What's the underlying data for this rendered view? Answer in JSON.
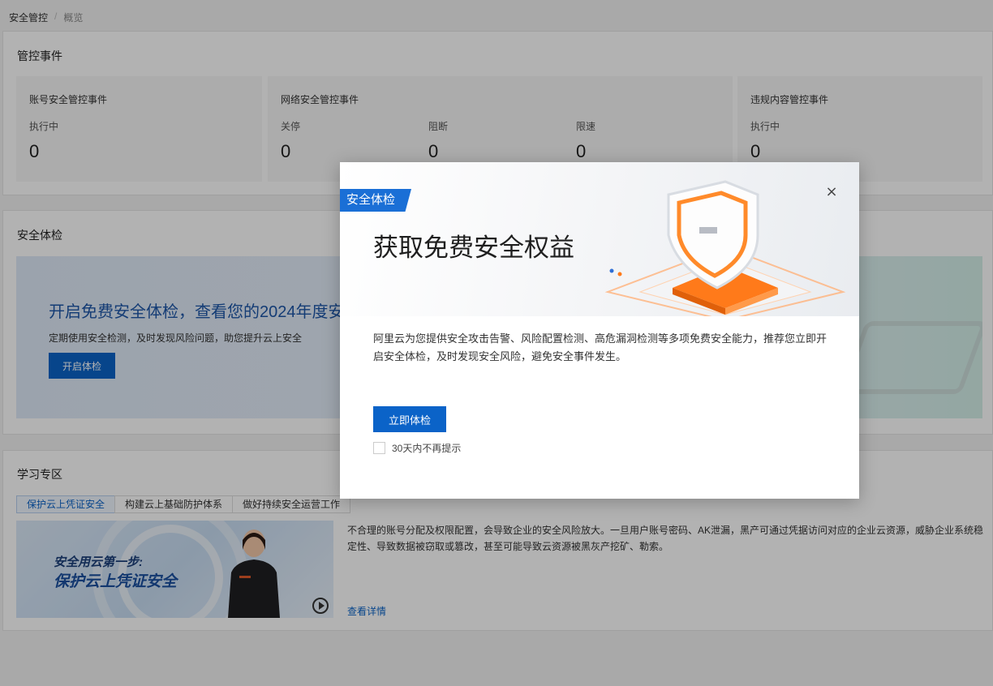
{
  "breadcrumb": {
    "parent": "安全管控",
    "separator": "/",
    "current": "概览"
  },
  "events": {
    "title": "管控事件",
    "account": {
      "title": "账号安全管控事件",
      "items": [
        {
          "label": "执行中",
          "value": "0"
        }
      ]
    },
    "network": {
      "title": "网络安全管控事件",
      "items": [
        {
          "label": "关停",
          "value": "0"
        },
        {
          "label": "阻断",
          "value": "0"
        },
        {
          "label": "限速",
          "value": "0"
        }
      ]
    },
    "content": {
      "title": "违规内容管控事件",
      "items": [
        {
          "label": "执行中",
          "value": "0"
        }
      ]
    }
  },
  "health": {
    "title": "安全体检",
    "banner_title": "开启免费安全体检，查看您的2024年度安",
    "banner_desc": "定期使用安全检测，及时发现风险问题，助您提升云上安全",
    "button": "开启体检"
  },
  "learn": {
    "title": "学习专区",
    "tabs": [
      "保护云上凭证安全",
      "构建云上基础防护体系",
      "做好持续安全运营工作"
    ],
    "video_line1": "安全用云第一步:",
    "video_line2": "保护云上凭证安全",
    "desc": "不合理的账号分配及权限配置，会导致企业的安全风险放大。一旦用户账号密码、AK泄漏，黑产可通过凭据访问对应的企业云资源，威胁企业系统稳定性、导致数据被窃取或篡改，甚至可能导致云资源被黑灰产挖矿、勒索。",
    "link": "查看详情"
  },
  "modal": {
    "tag": "安全体检",
    "title": "获取免费安全权益",
    "close": "×",
    "body": "阿里云为您提供安全攻击告警、风险配置检测、高危漏洞检测等多项免费安全能力，推荐您立即开启安全体检，及时发现安全风险，避免安全事件发生。",
    "button": "立即体检",
    "checkbox_label": "30天内不再提示"
  },
  "colors": {
    "primary": "#0b63c8",
    "tag": "#1a6fd6",
    "accent_orange": "#ff7a1a"
  }
}
